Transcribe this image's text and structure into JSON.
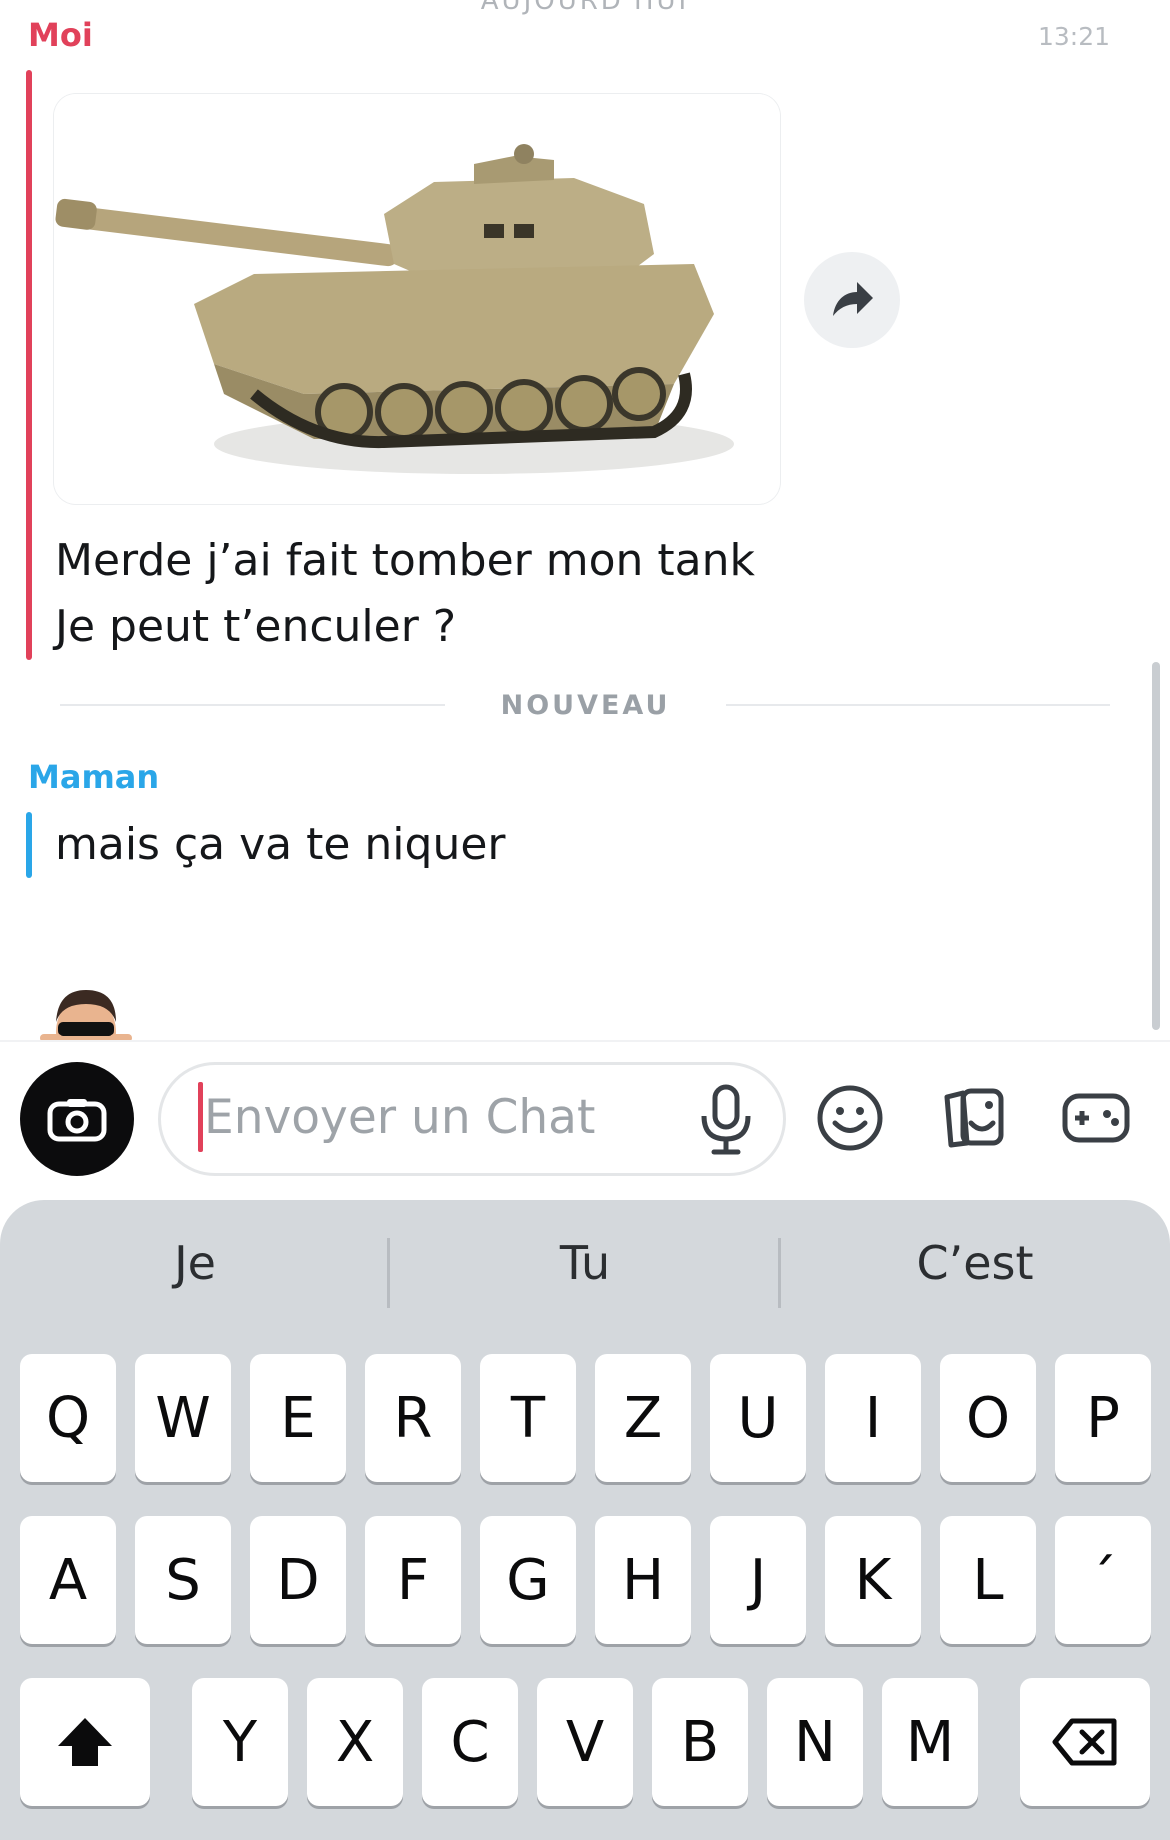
{
  "header": {
    "cut_label": "AUJOURD'HUI"
  },
  "conversation": {
    "my_message": {
      "sender": "Moi",
      "time": "13:21",
      "line1": "Merde j’ai fait tomber mon tank",
      "line2": "Je peut  t’enculer ?"
    },
    "divider_label": "NOUVEAU",
    "mom_message": {
      "sender": "Maman",
      "text": "mais ça va te niquer"
    }
  },
  "composer": {
    "placeholder": "Envoyer un Chat"
  },
  "keyboard": {
    "suggestions": [
      "Je",
      "Tu",
      "C’est"
    ],
    "row1": [
      "Q",
      "W",
      "E",
      "R",
      "T",
      "Z",
      "U",
      "I",
      "O",
      "P"
    ],
    "row2": [
      "A",
      "S",
      "D",
      "F",
      "G",
      "H",
      "J",
      "K",
      "L",
      "´"
    ],
    "row3": [
      "Y",
      "X",
      "C",
      "V",
      "B",
      "N",
      "M"
    ]
  },
  "colors": {
    "me": "#e1415a",
    "mom": "#2aa6e8",
    "keyboard_bg": "#d4d8dc"
  },
  "icons": [
    "share-icon",
    "camera-icon",
    "microphone-icon",
    "emoji-icon",
    "stickers-icon",
    "games-icon",
    "shift-icon",
    "backspace-icon"
  ]
}
